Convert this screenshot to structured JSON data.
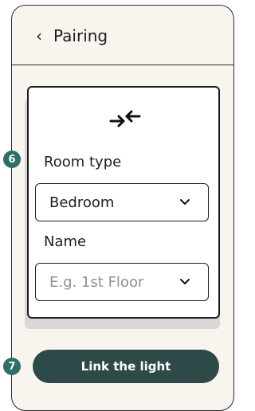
{
  "header": {
    "back_label": "Pairing",
    "back_icon": "chevron-left-icon"
  },
  "card": {
    "icon": "pair-arrows-icon",
    "room_type": {
      "label": "Room type",
      "value": "Bedroom"
    },
    "name": {
      "label": "Name",
      "placeholder": "E.g. 1st Floor"
    }
  },
  "annotations": {
    "badge_6": "6",
    "badge_7": "7"
  },
  "actions": {
    "link_label": "Link the light"
  },
  "colors": {
    "accent": "#2f6f68",
    "primary_button": "#2e4a48",
    "background": "#f8f4ee",
    "border": "#1d1d1d"
  }
}
